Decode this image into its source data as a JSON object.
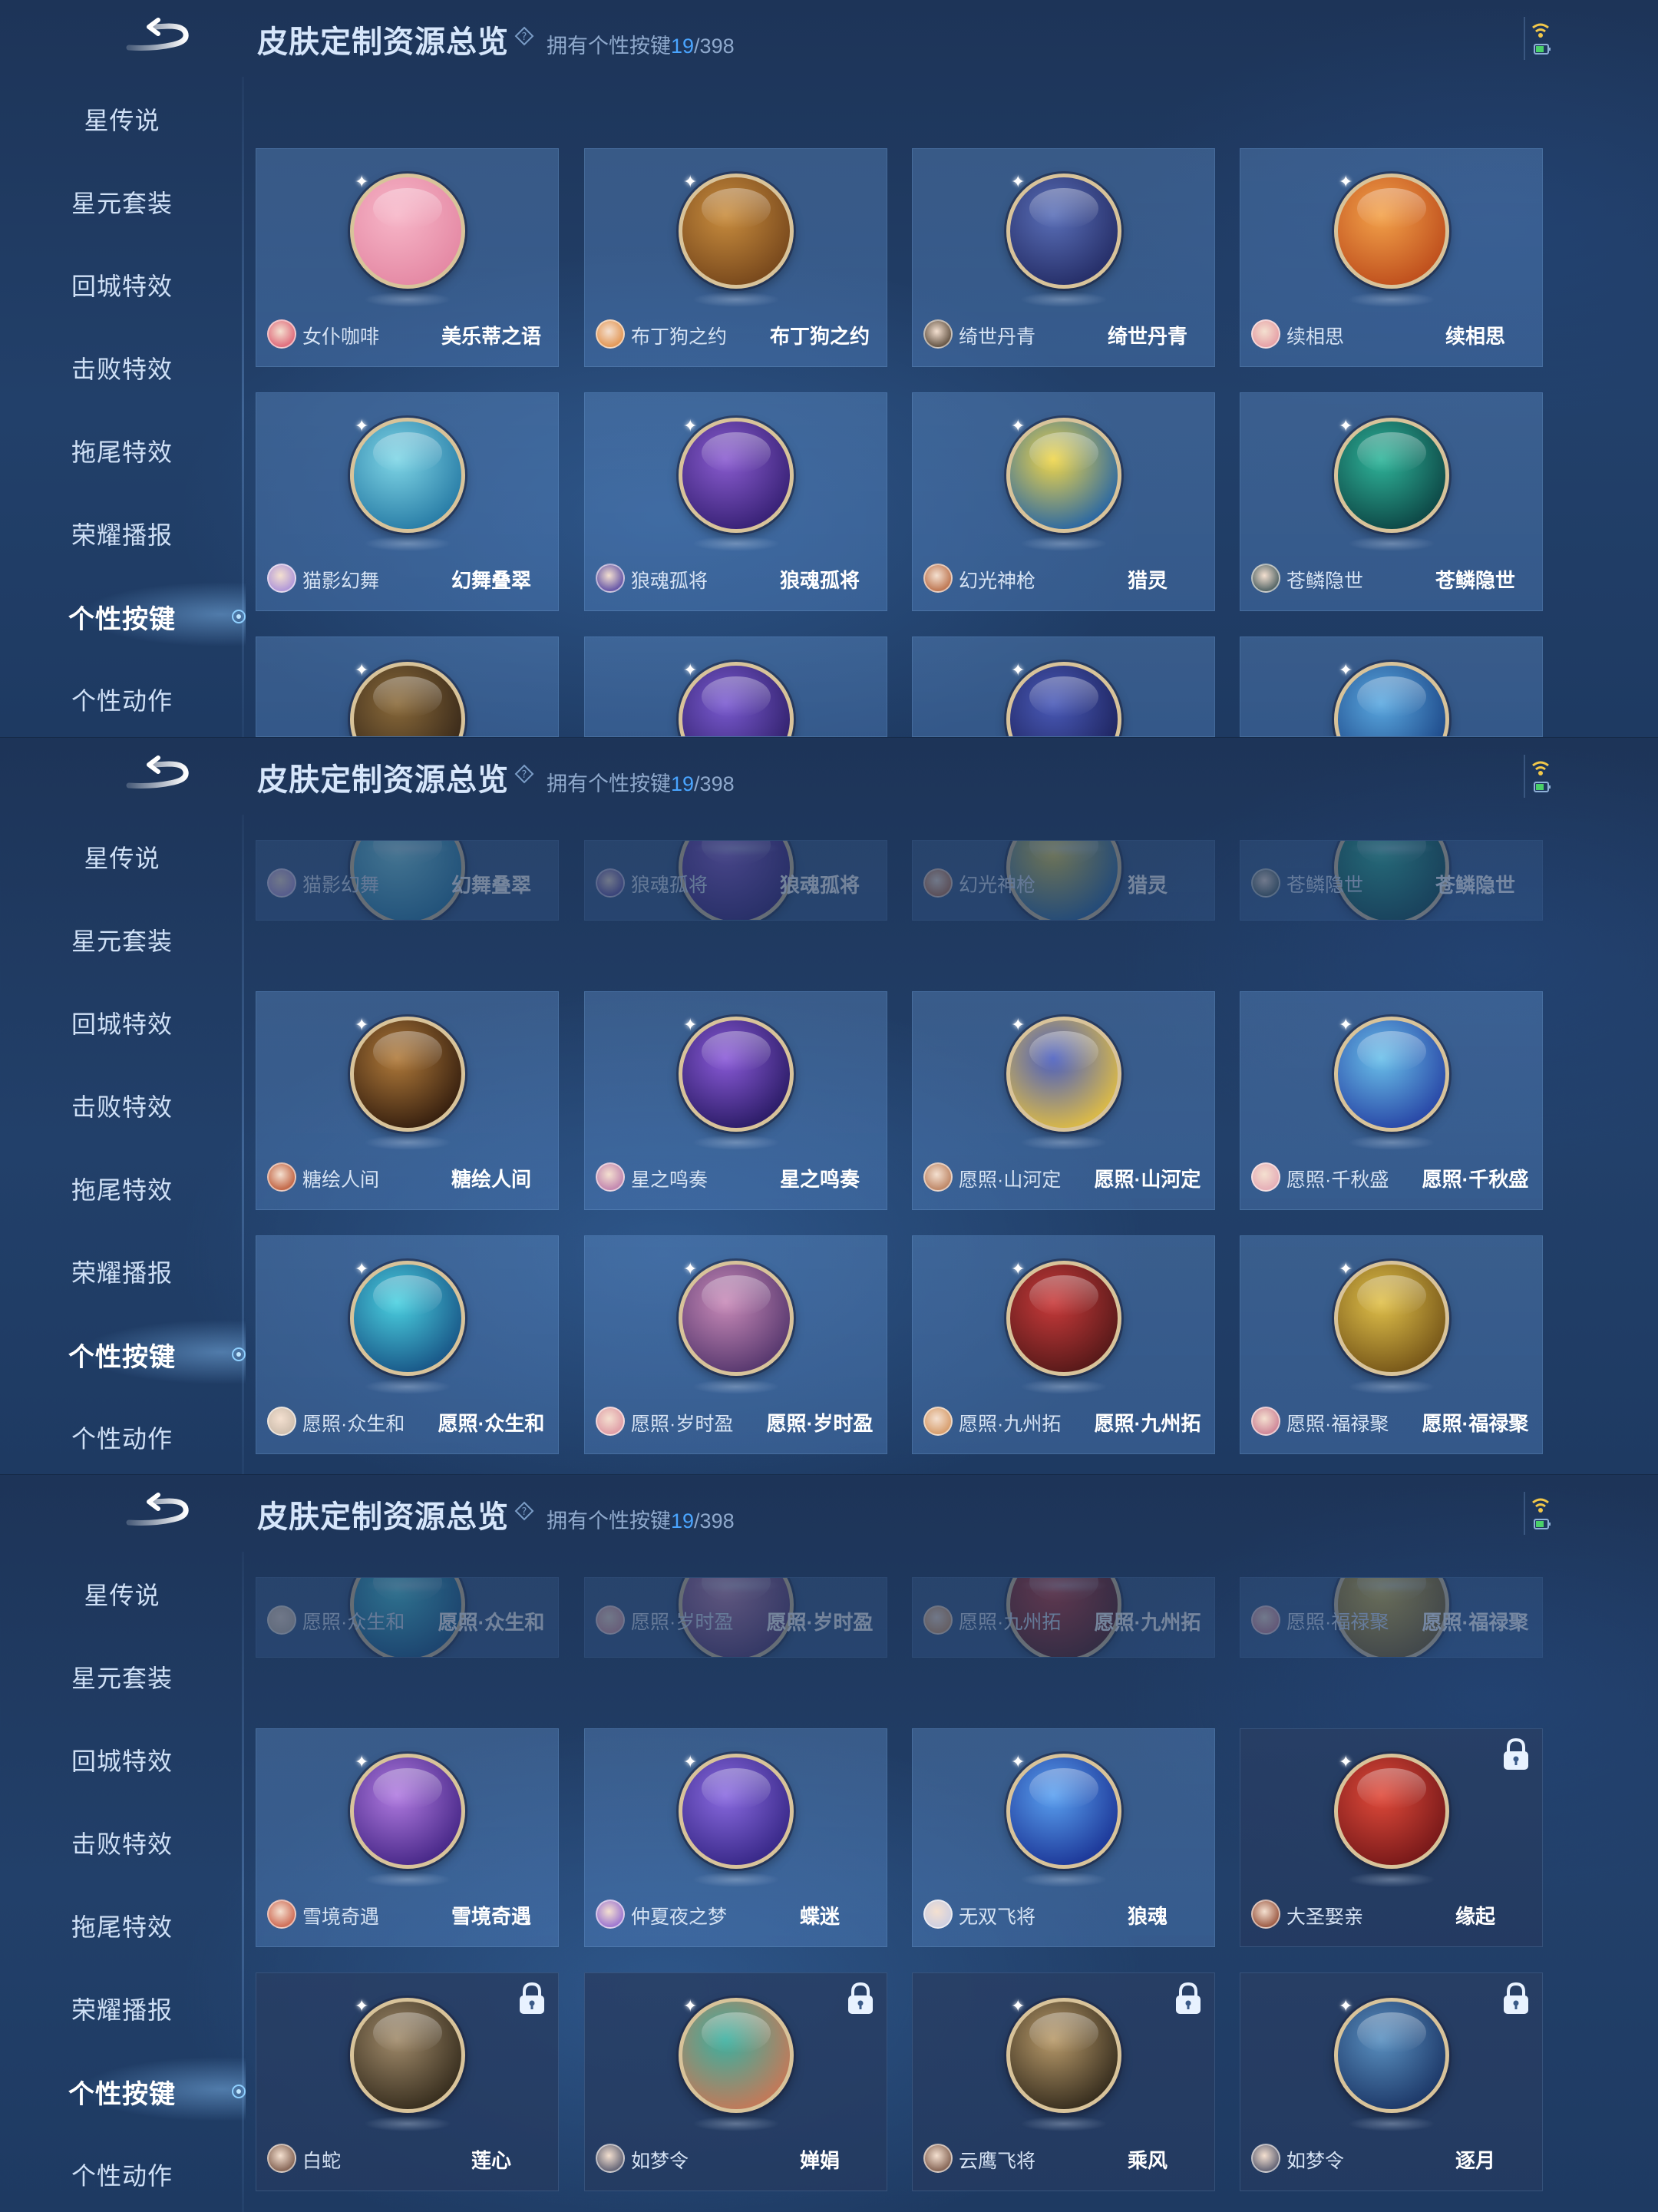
{
  "header": {
    "title": "皮肤定制资源总览",
    "owned_prefix": "拥有个性按键",
    "owned_count": "19",
    "owned_total": "/398"
  },
  "sidebar": {
    "items": [
      "星传说",
      "星元套装",
      "回城特效",
      "击败特效",
      "拖尾特效",
      "荣耀播报",
      "个性按键",
      "个性动作"
    ],
    "active": "个性按键"
  },
  "panels": [
    {
      "rows": [
        [
          {
            "hero": "女仆咖啡",
            "skin": "美乐蒂之语",
            "colors": [
              "#f7b6c8",
              "#e58aa5"
            ],
            "avatar": "#e0707f"
          },
          {
            "hero": "布丁狗之约",
            "skin": "布丁狗之约",
            "colors": [
              "#c98d3e",
              "#7a4a1d"
            ],
            "avatar": "#e39a5a"
          },
          {
            "hero": "绮世丹青",
            "skin": "绮世丹青",
            "colors": [
              "#5a6fb8",
              "#27306a"
            ],
            "avatar": "#6a5a4a"
          },
          {
            "hero": "续相思",
            "skin": "续相思",
            "colors": [
              "#f3a24a",
              "#c0511e"
            ],
            "avatar": "#e6a3a8"
          }
        ],
        [
          {
            "hero": "猫影幻舞",
            "skin": "幻舞叠翠",
            "colors": [
              "#7fd6e6",
              "#2b7fa8"
            ],
            "avatar": "#b39ad8"
          },
          {
            "hero": "狼魂孤将",
            "skin": "狼魂孤将",
            "colors": [
              "#8a5cd0",
              "#3a2378"
            ],
            "avatar": "#6a5aa8"
          },
          {
            "hero": "幻光神枪",
            "skin": "猎灵",
            "colors": [
              "#f0d64a",
              "#2f6aa0"
            ],
            "avatar": "#c07a56"
          },
          {
            "hero": "苍鳞隐世",
            "skin": "苍鳞隐世",
            "colors": [
              "#2fb59a",
              "#0e4a48"
            ],
            "avatar": "#5a6a6a"
          }
        ],
        [
          {
            "hero": "",
            "skin": "",
            "colors": [
              "#8a6a3a",
              "#3a2a1a"
            ],
            "avatar": ""
          },
          {
            "hero": "",
            "skin": "",
            "colors": [
              "#7a5ad0",
              "#32226e"
            ],
            "avatar": ""
          },
          {
            "hero": "",
            "skin": "",
            "colors": [
              "#4a5ab8",
              "#1e2560"
            ],
            "avatar": ""
          },
          {
            "hero": "",
            "skin": "",
            "colors": [
              "#5aa8e0",
              "#1e4a8a"
            ],
            "avatar": ""
          }
        ]
      ]
    },
    {
      "rows": [
        [
          {
            "hero": "猫影幻舞",
            "skin": "幻舞叠翠",
            "colors": [
              "#7fd6e6",
              "#2b7fa8"
            ],
            "avatar": "#b39ad8"
          },
          {
            "hero": "狼魂孤将",
            "skin": "狼魂孤将",
            "colors": [
              "#8a5cd0",
              "#3a2378"
            ],
            "avatar": "#6a5aa8"
          },
          {
            "hero": "幻光神枪",
            "skin": "猎灵",
            "colors": [
              "#f0d64a",
              "#2f6aa0"
            ],
            "avatar": "#c07a56"
          },
          {
            "hero": "苍鳞隐世",
            "skin": "苍鳞隐世",
            "colors": [
              "#2fb59a",
              "#0e4a48"
            ],
            "avatar": "#5a6a6a"
          }
        ],
        [
          {
            "hero": "糖绘人间",
            "skin": "糖绘人间",
            "colors": [
              "#b07a3a",
              "#3a2210"
            ],
            "avatar": "#c46a4a"
          },
          {
            "hero": "星之鸣奏",
            "skin": "星之鸣奏",
            "colors": [
              "#8a5ad8",
              "#2e1e6a"
            ],
            "avatar": "#c48ab0"
          },
          {
            "hero": "愿照·山河定",
            "skin": "愿照·山河定",
            "colors": [
              "#4a5ec0",
              "#d8b84a"
            ],
            "avatar": "#c08a6a"
          },
          {
            "hero": "愿照·千秋盛",
            "skin": "愿照·千秋盛",
            "colors": [
              "#6ac0ea",
              "#2a4aa8"
            ],
            "avatar": "#e6b0b8"
          }
        ],
        [
          {
            "hero": "愿照·众生和",
            "skin": "愿照·众生和",
            "colors": [
              "#4ad0e0",
              "#1a5a8a"
            ],
            "avatar": "#d0c0b0"
          },
          {
            "hero": "愿照·岁时盈",
            "skin": "愿照·岁时盈",
            "colors": [
              "#c88ab8",
              "#5a3a70"
            ],
            "avatar": "#e0a0a8"
          },
          {
            "hero": "愿照·九州拓",
            "skin": "愿照·九州拓",
            "colors": [
              "#c83a3a",
              "#5a1a1a"
            ],
            "avatar": "#d8a070"
          },
          {
            "hero": "愿照·福禄聚",
            "skin": "愿照·福禄聚",
            "colors": [
              "#e0c04a",
              "#7a5a1a"
            ],
            "avatar": "#d08a9a"
          }
        ]
      ]
    },
    {
      "rows": [
        [
          {
            "hero": "愿照·众生和",
            "skin": "愿照·众生和",
            "colors": [
              "#4ad0e0",
              "#1a5a8a"
            ],
            "avatar": "#d0c0b0"
          },
          {
            "hero": "愿照·岁时盈",
            "skin": "愿照·岁时盈",
            "colors": [
              "#c88ab8",
              "#5a3a70"
            ],
            "avatar": "#e0a0a8"
          },
          {
            "hero": "愿照·九州拓",
            "skin": "愿照·九州拓",
            "colors": [
              "#c83a3a",
              "#5a1a1a"
            ],
            "avatar": "#d8a070"
          },
          {
            "hero": "愿照·福禄聚",
            "skin": "愿照·福禄聚",
            "colors": [
              "#e0c04a",
              "#7a5a1a"
            ],
            "avatar": "#d08a9a"
          }
        ],
        [
          {
            "hero": "雪境奇遇",
            "skin": "雪境奇遇",
            "colors": [
              "#b07ae0",
              "#4a2a8a"
            ],
            "avatar": "#d0705a",
            "locked": false
          },
          {
            "hero": "仲夏夜之梦",
            "skin": "蝶迷",
            "colors": [
              "#8a6ae0",
              "#3a2a8a"
            ],
            "avatar": "#a07ad0",
            "locked": false
          },
          {
            "hero": "无双飞将",
            "skin": "狼魂",
            "colors": [
              "#5aa0f0",
              "#1e3a9a"
            ],
            "avatar": "#d0d0e0",
            "locked": false
          },
          {
            "hero": "大圣娶亲",
            "skin": "缘起",
            "colors": [
              "#e04a3a",
              "#7a1a1a"
            ],
            "avatar": "#a0604a",
            "locked": true
          }
        ],
        [
          {
            "hero": "白蛇",
            "skin": "莲心",
            "colors": [
              "#a08a6a",
              "#3a3020"
            ],
            "avatar": "#8a6a5a",
            "locked": true
          },
          {
            "hero": "如梦令",
            "skin": "婵娟",
            "colors": [
              "#3ab0a0",
              "#c07a5a"
            ],
            "avatar": "#6a6a7a",
            "locked": true
          },
          {
            "hero": "云鹰飞将",
            "skin": "乘风",
            "colors": [
              "#b89a6a",
              "#3a3020"
            ],
            "avatar": "#8a6a5a",
            "locked": true
          },
          {
            "hero": "如梦令",
            "skin": "逐月",
            "colors": [
              "#5a90c0",
              "#1e3a6a"
            ],
            "avatar": "#6a6a7a",
            "locked": true
          }
        ]
      ]
    }
  ],
  "icons": {
    "back": "back-arrow-icon",
    "help": "help-diamond-icon",
    "wifi": "wifi-icon",
    "battery": "battery-icon",
    "lock": "lock-icon"
  }
}
